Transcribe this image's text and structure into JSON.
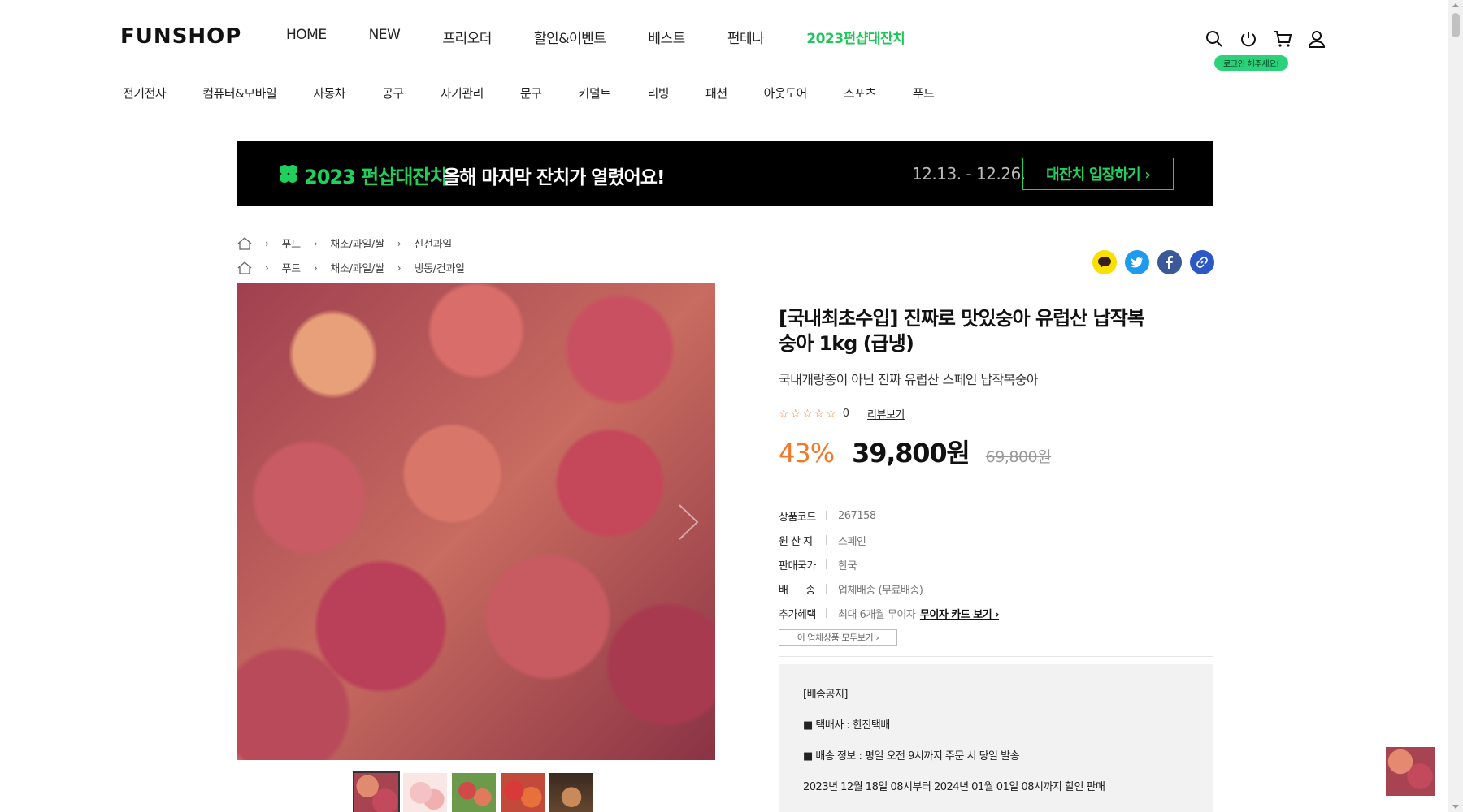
{
  "brand": {
    "logo": "FUNSHOP",
    "accent": "#1fc65a",
    "price_color": "#f07a2a"
  },
  "gnb": [
    "HOME",
    "NEW",
    "프리오더",
    "할인&이벤트",
    "베스트",
    "펀테나",
    "2023펀샵대잔치"
  ],
  "util": {
    "login_tooltip": "로그인 해주세요!",
    "icons": [
      "search-icon",
      "power-icon",
      "cart-icon",
      "user-icon"
    ]
  },
  "categories": [
    "전기전자",
    "컴퓨터&모바일",
    "자동차",
    "공구",
    "자기관리",
    "문구",
    "키덜트",
    "리빙",
    "패션",
    "아웃도어",
    "스포츠",
    "푸드"
  ],
  "banner": {
    "title": "2023 펀샵대잔치",
    "subtitle": "올해 마지막 잔치가 열렸어요!",
    "date": "12.13. - 12.26.",
    "cta": "대잔치 입장하기 ›"
  },
  "breadcrumbs": [
    [
      "푸드",
      "채소/과일/쌀",
      "신선과일"
    ],
    [
      "푸드",
      "채소/과일/쌀",
      "냉동/건과일"
    ]
  ],
  "product": {
    "title": "[국내최초수입] 진짜로 맛있숭아 유럽산 납작복숭아 1kg (급냉)",
    "description": "국내개량종이 아닌 진짜 유럽산 스페인 납작복숭아",
    "stars": "☆☆☆☆☆",
    "review_count": "0",
    "review_link": "리뷰보기",
    "discount": "43%",
    "price": "39,800원",
    "original_price": "69,800원",
    "specs": [
      {
        "k": "상품코드",
        "v": "267158"
      },
      {
        "k": "원 산 지",
        "v": "스페인"
      },
      {
        "k": "판매국가",
        "v": "한국"
      },
      {
        "k": "배      송",
        "v": "업체배송 (무료배송)"
      },
      {
        "k": "추가혜택",
        "v": "최대 6개월 무이자",
        "link": "무이자 카드 보기 ›"
      }
    ],
    "vendor_button": "이 업체상품 모두보기  ›"
  },
  "notice": {
    "title": "[배송공지]",
    "lines": [
      "■ 택배사 : 한진택배",
      "■ 배송 정보 : 평일 오전 9시까지 주문 시 당일 발송",
      "2023년 12월 18일 08시부터 2024년 01월 01일 08시까지 할인 판매"
    ]
  }
}
